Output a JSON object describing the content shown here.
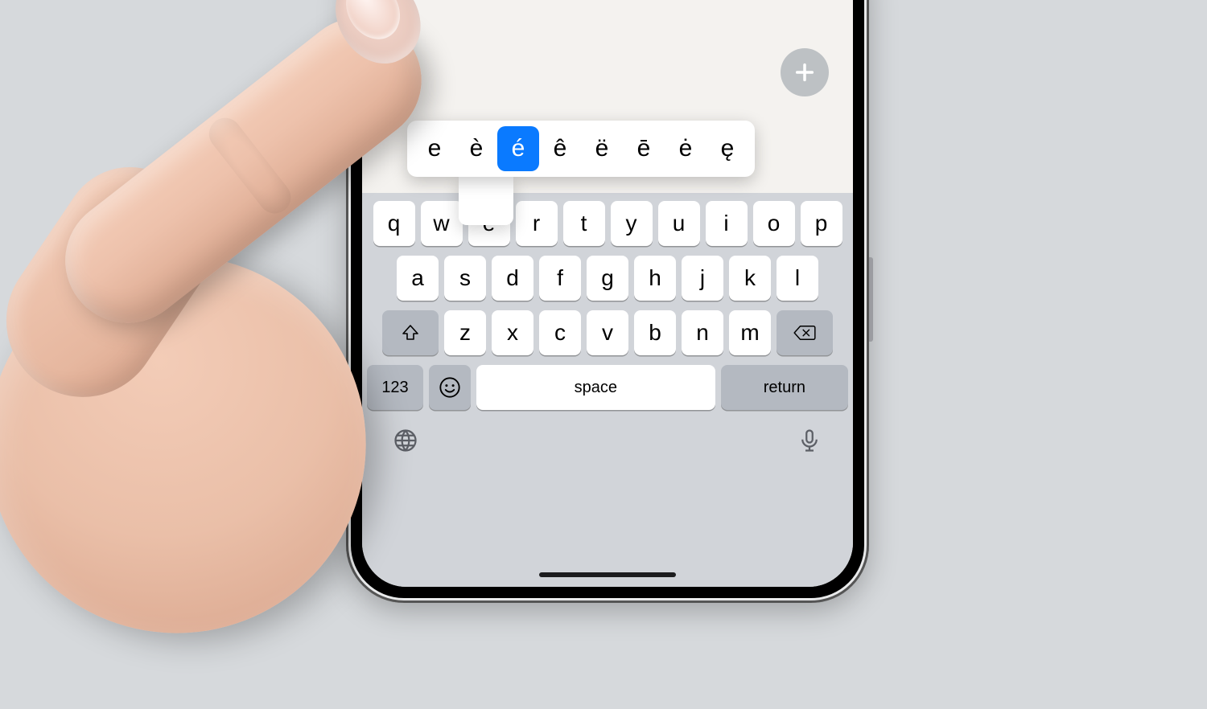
{
  "accent_options": [
    "e",
    "è",
    "é",
    "ê",
    "ë",
    "ē",
    "ė",
    "ę"
  ],
  "accent_selected_index": 2,
  "keyboard": {
    "row1": [
      "q",
      "w",
      "e",
      "r",
      "t",
      "y",
      "u",
      "i",
      "o",
      "p"
    ],
    "row2": [
      "a",
      "s",
      "d",
      "f",
      "g",
      "h",
      "j",
      "k",
      "l"
    ],
    "row3": [
      "z",
      "x",
      "c",
      "v",
      "b",
      "n",
      "m"
    ],
    "space_label": "space",
    "return_label": "return",
    "abc_label": "123"
  },
  "icons": {
    "add": "plus-icon",
    "shift": "shift-icon",
    "delete": "delete-icon",
    "emoji": "emoji-icon",
    "globe": "globe-icon",
    "mic": "mic-icon"
  },
  "colors": {
    "selection_blue": "#0a7aff",
    "key_white": "#ffffff",
    "key_gray": "#b4b9c1",
    "keyboard_bg": "#d1d4d9",
    "page_bg": "#d6d9dc"
  }
}
